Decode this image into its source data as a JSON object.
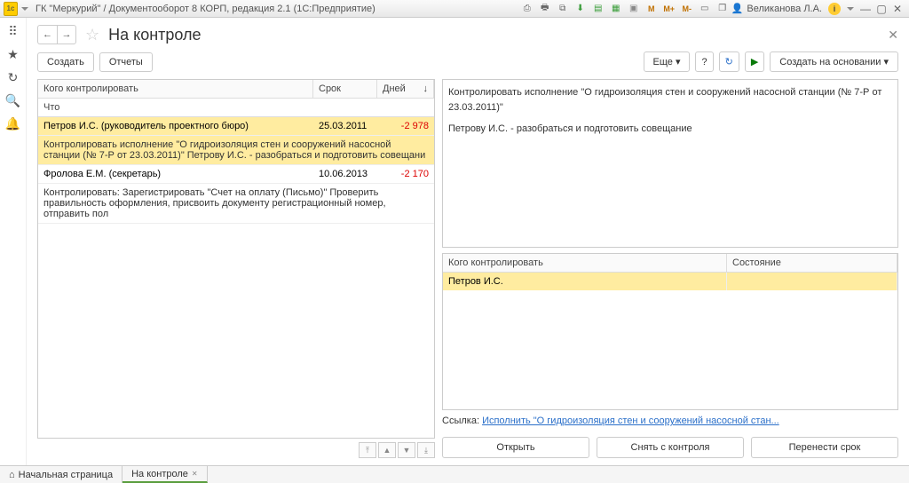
{
  "window": {
    "title": "ГК \"Меркурий\" / Документооборот 8 КОРП, редакция 2.1  (1С:Предприятие)",
    "user": "Великанова Л.А."
  },
  "sysbar_icons": {
    "m": "M",
    "mplus": "M+",
    "mminus": "M-"
  },
  "page": {
    "title": "На контроле",
    "create": "Создать",
    "reports": "Отчеты",
    "more": "Еще",
    "help": "?",
    "createBased": "Создать на основании"
  },
  "grid": {
    "col_who": "Кого контролировать",
    "col_due": "Срок",
    "col_days": "Дней",
    "col_what": "Что",
    "rows": [
      {
        "who": "Петров И.С. (руководитель проектного бюро)",
        "due": "25.03.2011",
        "days": "-2 978",
        "detail": "Контролировать исполнение \"О гидроизоляция стен и сооружений насосной станции (№ 7-Р от 23.03.2011)\" Петрову И.С. - разобраться и подготовить совещани"
      },
      {
        "who": "Фролова Е.М. (секретарь)",
        "due": "10.06.2013",
        "days": "-2 170",
        "detail": "Контролировать: Зарегистрировать \"Счет на оплату (Письмо)\" Проверить правильность оформления, присвоить документу регистрационный номер, отправить пол"
      }
    ]
  },
  "detail": {
    "line1": "Контролировать исполнение \"О гидроизоляция стен и сооружений насосной станции (№ 7-Р от 23.03.2011)\"",
    "line2": "Петрову И.С. - разобраться и подготовить совещание",
    "sub_col_who": "Кого контролировать",
    "sub_col_state": "Состояние",
    "sub_rows": [
      {
        "who": "Петров И.С.",
        "state": ""
      }
    ],
    "link_label": "Ссылка:",
    "link_text": "Исполнить \"О гидроизоляция стен и сооружений насосной стан...",
    "btn_open": "Открыть",
    "btn_remove": "Снять с контроля",
    "btn_move": "Перенести срок"
  },
  "tabs": {
    "home": "Начальная страница",
    "current": "На контроле"
  }
}
